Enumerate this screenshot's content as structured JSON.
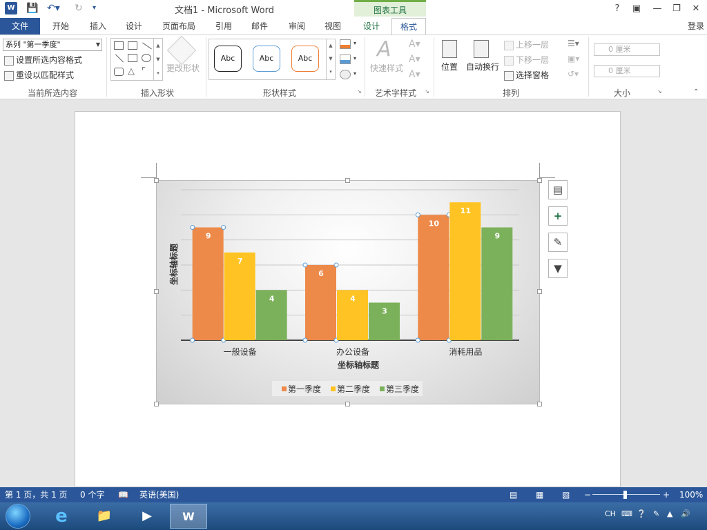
{
  "title_bar": {
    "doc_title": "文档1 - Microsoft Word",
    "tools_tab": "图表工具",
    "help": "?",
    "window_controls": [
      "help-icon",
      "ribbon-display-icon",
      "minimize-icon",
      "restore-icon",
      "close-icon"
    ]
  },
  "tabs": [
    "文件",
    "开始",
    "插入",
    "设计",
    "页面布局",
    "引用",
    "邮件",
    "审阅",
    "视图",
    "设计",
    "格式"
  ],
  "login": "登录",
  "ribbon": {
    "current_selection": {
      "dropdown_value": "系列 \"第一季度\"",
      "format_selection": "设置所选内容格式",
      "reset_style": "重设以匹配样式",
      "label": "当前所选内容"
    },
    "insert_shapes": {
      "change_shape": "更改形状",
      "label": "插入形状"
    },
    "shape_styles": {
      "abc_items": [
        "Abc",
        "Abc",
        "Abc"
      ],
      "abc_colors": [
        "#222222",
        "#5b9bd5",
        "#ed7d31"
      ],
      "label": "形状样式"
    },
    "wordart": {
      "quick_styles": "快速样式",
      "label": "艺术字样式"
    },
    "arrange": {
      "position": "位置",
      "wrap_text": "自动换行",
      "bring_forward": "上移一层",
      "send_backward": "下移一层",
      "selection_pane": "选择窗格",
      "label": "排列"
    },
    "size": {
      "height": "0 厘米",
      "width": "0 厘米",
      "label": "大小"
    }
  },
  "chart_data": {
    "type": "bar",
    "categories": [
      "一般设备",
      "办公设备",
      "消耗用品"
    ],
    "series": [
      {
        "name": "第一季度",
        "values": [
          9,
          6,
          10
        ],
        "color": "#ed8a4a"
      },
      {
        "name": "第二季度",
        "values": [
          7,
          4,
          11
        ],
        "color": "#ffc423"
      },
      {
        "name": "第三季度",
        "values": [
          4,
          3,
          9
        ],
        "color": "#7cb15b"
      }
    ],
    "title": "",
    "xlabel": "坐标轴标题",
    "ylabel": "坐标轴标题",
    "ylim": [
      0,
      12
    ],
    "grid": true,
    "legend_position": "bottom",
    "data_labels": true,
    "selected_series": "第一季度"
  },
  "chart_side_buttons": [
    "chart-layout-icon",
    "chart-elements-plus-icon",
    "chart-styles-brush-icon",
    "chart-filter-icon"
  ],
  "status_bar": {
    "page": "第 1 页，共 1 页",
    "words": "0 个字",
    "language": "英语(美国)",
    "zoom": "100%"
  },
  "taskbar": {
    "tray_lang": "CH"
  }
}
